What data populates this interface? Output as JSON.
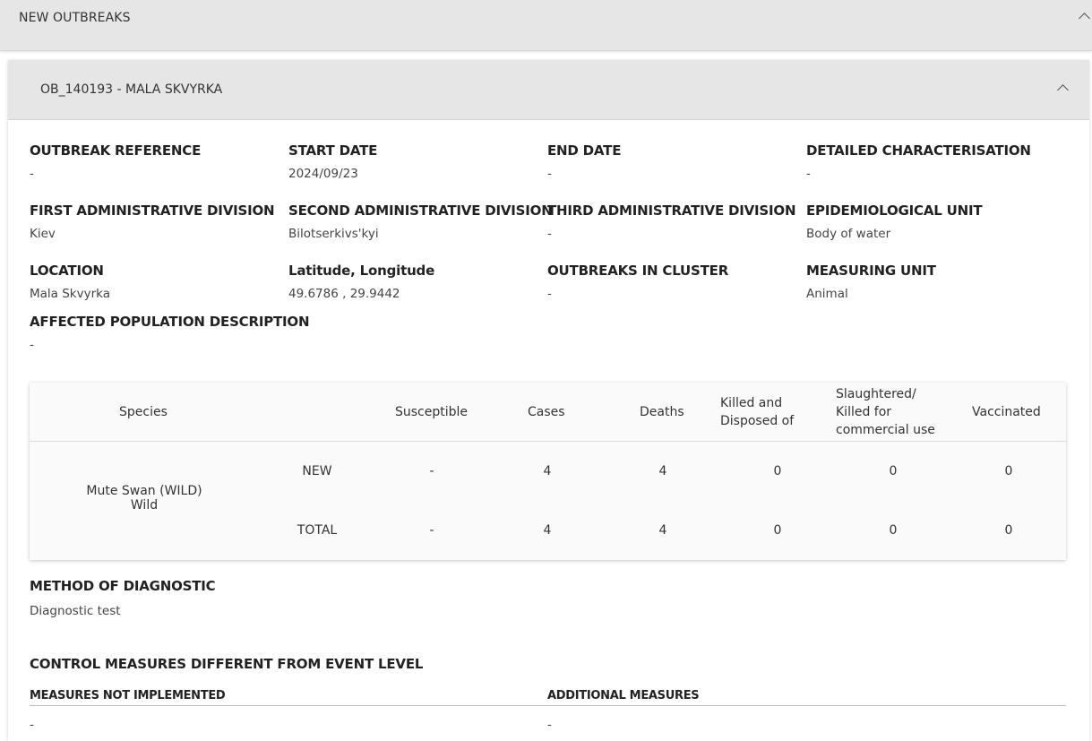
{
  "header": {
    "title": "NEW OUTBREAKS"
  },
  "outbreak": {
    "title": "OB_140193 - MALA SKVYRKA"
  },
  "fields": [
    {
      "label": "OUTBREAK REFERENCE",
      "value": "-"
    },
    {
      "label": "START DATE",
      "value": "2024/09/23"
    },
    {
      "label": "END DATE",
      "value": "-"
    },
    {
      "label": "DETAILED CHARACTERISATION",
      "value": "-"
    },
    {
      "label": "FIRST ADMINISTRATIVE DIVISION",
      "value": "Kiev"
    },
    {
      "label": "SECOND ADMINISTRATIVE DIVISION",
      "value": "Bilotserkivs'kyi"
    },
    {
      "label": "THIRD ADMINISTRATIVE DIVISION",
      "value": "-"
    },
    {
      "label": "EPIDEMIOLOGICAL UNIT",
      "value": "Body of water"
    },
    {
      "label": "LOCATION",
      "value": "Mala Skvyrka"
    },
    {
      "label": "Latitude, Longitude",
      "value": "49.6786 , 29.9442"
    },
    {
      "label": "OUTBREAKS IN CLUSTER",
      "value": "-"
    },
    {
      "label": "MEASURING UNIT",
      "value": "Animal"
    },
    {
      "label": "AFFECTED POPULATION DESCRIPTION",
      "value": "-"
    }
  ],
  "table": {
    "headers": {
      "species": "Species",
      "susceptible": "Susceptible",
      "cases": "Cases",
      "deaths": "Deaths",
      "killed_1": "Killed and",
      "killed_2": "Disposed of",
      "slaughtered_1": "Slaughtered/",
      "slaughtered_2": "Killed for",
      "slaughtered_3": "commercial use",
      "vaccinated": "Vaccinated"
    },
    "species_name": "Mute Swan (WILD)",
    "species_type": "Wild",
    "rows": [
      {
        "label": "NEW",
        "susceptible": "-",
        "cases": "4",
        "deaths": "4",
        "killed": "0",
        "slaughtered": "0",
        "vaccinated": "0"
      },
      {
        "label": "TOTAL",
        "susceptible": "-",
        "cases": "4",
        "deaths": "4",
        "killed": "0",
        "slaughtered": "0",
        "vaccinated": "0"
      }
    ]
  },
  "diagnostic": {
    "title": "METHOD OF DIAGNOSTIC",
    "value": "Diagnostic test"
  },
  "control": {
    "title": "CONTROL MEASURES DIFFERENT FROM EVENT LEVEL",
    "not_implemented_label": "MEASURES NOT IMPLEMENTED",
    "not_implemented_value": "-",
    "additional_label": "ADDITIONAL MEASURES",
    "additional_value": "-"
  }
}
